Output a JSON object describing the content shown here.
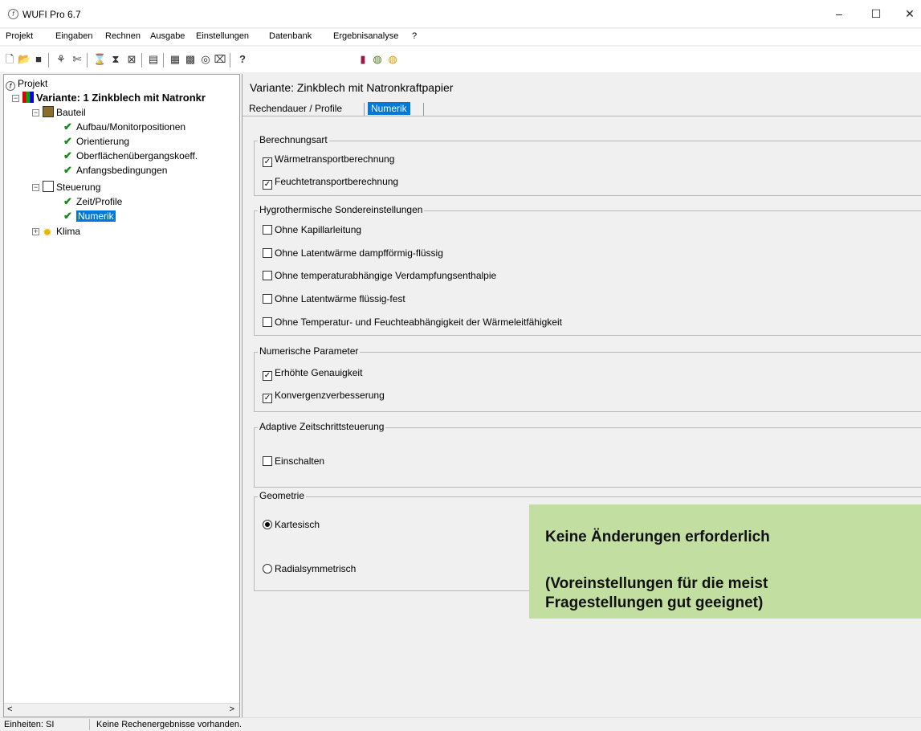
{
  "window": {
    "title": "WUFI Pro 6.7",
    "minimize": "–",
    "maximize": "☐",
    "close": "✕"
  },
  "menu": [
    "Projekt",
    "Eingaben",
    "Rechnen",
    "Ausgabe",
    "Einstellungen",
    "Datenbank",
    "Ergebnisanalyse",
    "?"
  ],
  "toolbar": {
    "help_label": "?",
    "icons": [
      "new-document-icon",
      "open-folder-icon",
      "save-icon",
      "variant-add-icon",
      "variant-delete-icon",
      "calculate-icon",
      "calculate-all-icon",
      "monitor-icon",
      "table-icon",
      "report-icon",
      "graph-icon",
      "database-icon",
      "export-icon",
      "help-icon",
      "building-icon",
      "wufi-logo-icon",
      "wufi-logo-yellow-icon"
    ]
  },
  "tree": {
    "root": "Projekt",
    "variant": "Variante: 1 Zinkblech mit Natronkr",
    "bauteil": "Bauteil",
    "bauteil_items": [
      "Aufbau/Monitorpositionen",
      "Orientierung",
      "Oberflächenübergangskoeff.",
      "Anfangsbedingungen"
    ],
    "steuerung": "Steuerung",
    "steuerung_items": [
      "Zeit/Profile",
      "Numerik"
    ],
    "klima": "Klima",
    "scroll_left": "<",
    "scroll_right": ">"
  },
  "main": {
    "variant_title": "Variante:  Zinkblech mit Natronkraftpapier",
    "tabs": [
      "Rechendauer / Profile",
      "Numerik"
    ],
    "active_tab": "Numerik",
    "groups": {
      "berechnungsart": {
        "title": "Berechnungsart",
        "items": [
          {
            "label": "Wärmetransportberechnung",
            "checked": true
          },
          {
            "label": "Feuchtetransportberechnung",
            "checked": true
          }
        ]
      },
      "hygrothermisch": {
        "title": "Hygrothermische Sondereinstellungen",
        "items": [
          {
            "label": "Ohne Kapillarleitung",
            "checked": false
          },
          {
            "label": "Ohne Latentwärme dampfförmig-flüssig",
            "checked": false
          },
          {
            "label": "Ohne temperaturabhängige Verdampfungsenthalpie",
            "checked": false
          },
          {
            "label": "Ohne Latentwärme flüssig-fest",
            "checked": false
          },
          {
            "label": "Ohne Temperatur- und Feuchteabhängigkeit der Wärmeleitfähigkeit",
            "checked": false
          }
        ]
      },
      "numerisch": {
        "title": "Numerische Parameter",
        "items": [
          {
            "label": "Erhöhte Genauigkeit",
            "checked": true
          },
          {
            "label": "Konvergenzverbesserung",
            "checked": true
          }
        ]
      },
      "adaptiv": {
        "title": "Adaptive Zeitschrittsteuerung",
        "items": [
          {
            "label": "Einschalten",
            "checked": false
          }
        ]
      },
      "geometrie": {
        "title": "Geometrie",
        "options": [
          {
            "label": "Kartesisch",
            "selected": true
          },
          {
            "label": "Radialsymmetrisch",
            "selected": false
          }
        ]
      }
    }
  },
  "note": {
    "line1": "Keine Änderungen erforderlich",
    "line2": "(Voreinstellungen für die meist",
    "line3": "Fragestellungen gut geeignet)",
    "background": "#c2dfa1"
  },
  "status": {
    "units": "Einheiten: SI",
    "message": "Keine Rechenergebnisse vorhanden."
  },
  "colors": {
    "accent": "#0078d7",
    "check": "#1a8a1a"
  }
}
